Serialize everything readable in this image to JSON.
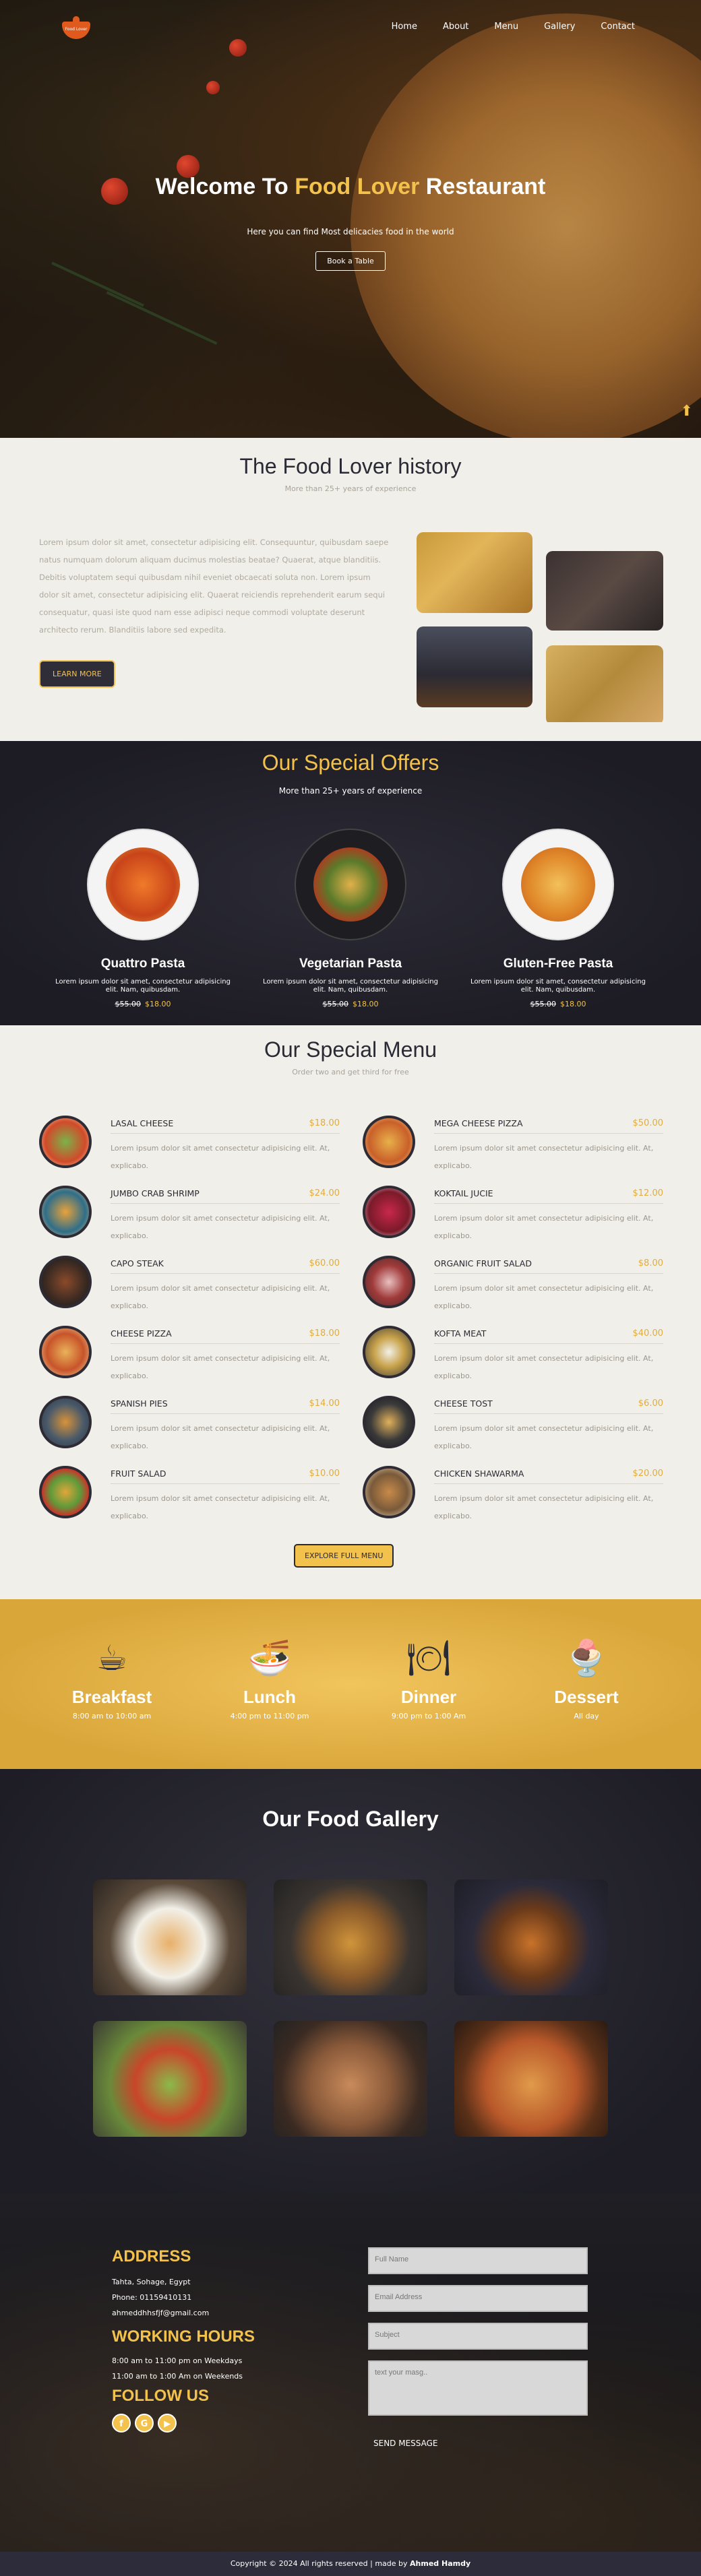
{
  "nav": {
    "logo_text": "Food Lover",
    "items": [
      "Home",
      "About",
      "Menu",
      "Gallery",
      "Contact"
    ]
  },
  "hero": {
    "title_pre": "Welcome To ",
    "title_highlight": "Food Lover",
    "title_post": " Restaurant",
    "subtitle": "Here you can find Most delicacies food in the world",
    "button": "Book a Table"
  },
  "history": {
    "title": "The Food Lover history",
    "subtitle": "More than 25+ years of experience",
    "paragraph": "Lorem ipsum dolor sit amet, consectetur adipisicing elit. Consequuntur, quibusdam saepe natus numquam dolorum aliquam ducimus molestias beatae? Quaerat, atque blanditiis. Debitis voluptatem sequi quibusdam nihil eveniet obcaecati soluta non. Lorem ipsum dolor sit amet, consectetur adipisicing elit. Quaerat reiciendis reprehenderit earum sequi consequatur, quasi iste quod nam esse adipisci neque commodi voluptate deserunt architecto rerum. Blanditiis labore sed expedita.",
    "button": "LEARN MORE"
  },
  "offers": {
    "title": "Our Special Offers",
    "subtitle": "More than 25+ years of experience",
    "items": [
      {
        "name": "Quattro Pasta",
        "desc": "Lorem ipsum dolor sit amet, consectetur adipisicing elit. Nam, quibusdam.",
        "old": "$55.00",
        "new": "$18.00"
      },
      {
        "name": "Vegetarian Pasta",
        "desc": "Lorem ipsum dolor sit amet, consectetur adipisicing elit. Nam, quibusdam.",
        "old": "$55.00",
        "new": "$18.00"
      },
      {
        "name": "Gluten-Free Pasta",
        "desc": "Lorem ipsum dolor sit amet, consectetur adipisicing elit. Nam, quibusdam.",
        "old": "$55.00",
        "new": "$18.00"
      }
    ]
  },
  "menu": {
    "title": "Our Special Menu",
    "subtitle": "Order two and get third for free",
    "item_desc": "Lorem ipsum dolor sit amet consectetur adipisicing elit. At, explicabo.",
    "left": [
      {
        "name": "LASAL CHEESE",
        "price": "$18.00"
      },
      {
        "name": "JUMBO CRAB SHRIMP",
        "price": "$24.00"
      },
      {
        "name": "CAPO STEAK",
        "price": "$60.00"
      },
      {
        "name": "CHEESE PIZZA",
        "price": "$18.00"
      },
      {
        "name": "SPANISH PIES",
        "price": "$14.00"
      },
      {
        "name": "FRUIT SALAD",
        "price": "$10.00"
      }
    ],
    "right": [
      {
        "name": "MEGA CHEESE PIZZA",
        "price": "$50.00"
      },
      {
        "name": "KOKTAIL JUCIE",
        "price": "$12.00"
      },
      {
        "name": "ORGANIC FRUIT SALAD",
        "price": "$8.00"
      },
      {
        "name": "KOFTA MEAT",
        "price": "$40.00"
      },
      {
        "name": "CHEESE TOST",
        "price": "$6.00"
      },
      {
        "name": "CHICKEN SHAWARMA",
        "price": "$20.00"
      }
    ],
    "button": "EXPLORE FULL MENU"
  },
  "meals": [
    {
      "name": "Breakfast",
      "time": "8:00 am to 10:00 am",
      "icon": "coffee-cup-icon"
    },
    {
      "name": "Lunch",
      "time": "4:00 pm to 11:00 pm",
      "icon": "bowl-icon"
    },
    {
      "name": "Dinner",
      "time": "9:00 pm to 1:00 Am",
      "icon": "plate-cutlery-icon"
    },
    {
      "name": "Dessert",
      "time": "All day",
      "icon": "ice-cream-icon"
    }
  ],
  "gallery": {
    "title": "Our Food Gallery"
  },
  "contact": {
    "address_title": "ADDRESS",
    "address": "Tahta, Sohage, Egypt",
    "phone": "Phone: 01159410131",
    "email": "ahmeddhhsfjf@gmail.com",
    "hours_title": "WORKING HOURS",
    "hours1": "8:00 am to 11:00 pm on Weekdays",
    "hours2": "11:00 am to 1:00 Am on Weekends",
    "follow_title": "FOLLOW US",
    "fields": {
      "name": "Full Name",
      "email": "Email Address",
      "subject": "Subject",
      "message": "text your masg.."
    },
    "send": "SEND MESSAGE"
  },
  "footer": {
    "text": "Copyright © 2024 All rights reserved | made by ",
    "author": "Ahmed Hamdy"
  },
  "colors": {
    "accent": "#f3c24d",
    "dark": "#2a2a35",
    "cream": "#f1efe9"
  }
}
